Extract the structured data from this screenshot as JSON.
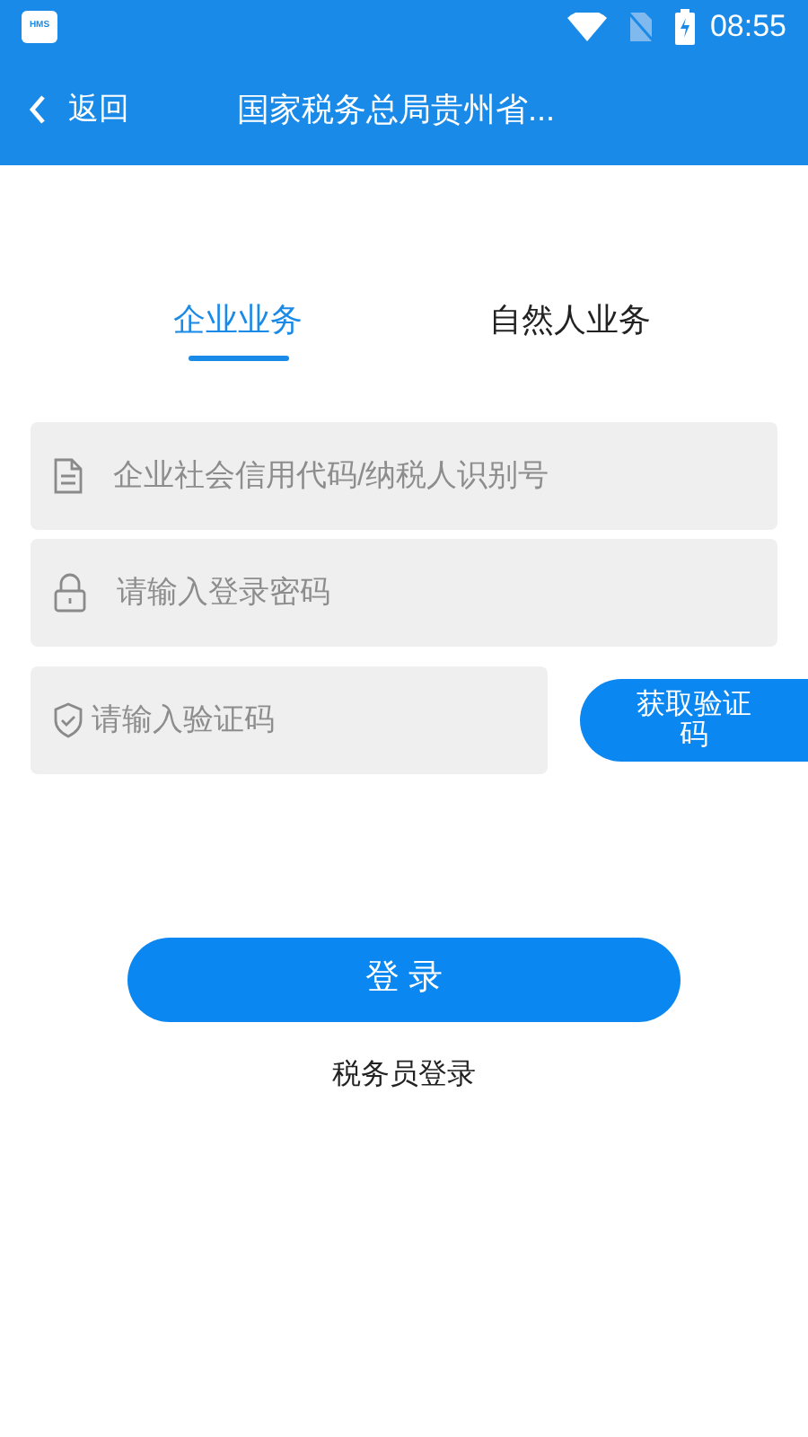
{
  "status_bar": {
    "app_badge": "HMS",
    "time": "08:55"
  },
  "header": {
    "back_label": "返回",
    "title": "国家税务总局贵州省..."
  },
  "tabs": [
    {
      "label": "企业业务",
      "selected": true
    },
    {
      "label": "自然人业务",
      "selected": false
    }
  ],
  "fields": [
    {
      "kind": "document",
      "placeholder": "企业社会信用代码/纳税人识别号"
    },
    {
      "kind": "lock",
      "placeholder": "请输入登录密码"
    },
    {
      "kind": "shield",
      "placeholder": "请输入验证码"
    }
  ],
  "code_button": "获取验证码",
  "login_button": "登 录",
  "staff_login": "税务员登录"
}
